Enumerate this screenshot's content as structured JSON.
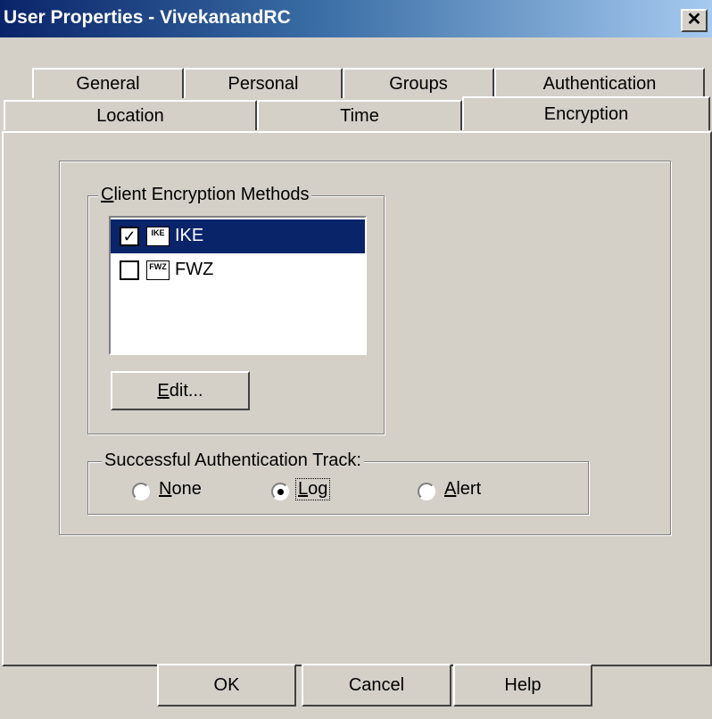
{
  "window": {
    "title": "User Properties - VivekanandRC",
    "close_glyph": "✕"
  },
  "tabs_back": [
    "General",
    "Personal",
    "Groups",
    "Authentication"
  ],
  "tabs_front": [
    "Location",
    "Time",
    "Encryption"
  ],
  "selected_tab": "Encryption",
  "encryption": {
    "group_label_ul": "C",
    "group_label_rest": "lient Encryption Methods",
    "methods": [
      {
        "label": "IKE",
        "icon_text": "IKE",
        "checked": true,
        "selected": true
      },
      {
        "label": "FWZ",
        "icon_text": "FWZ",
        "checked": false,
        "selected": false
      }
    ],
    "edit_ul": "E",
    "edit_rest": "dit..."
  },
  "track": {
    "label": "Successful Authentication Track:",
    "options": [
      {
        "ul": "N",
        "rest": "one",
        "selected": false
      },
      {
        "ul": "L",
        "rest": "og",
        "selected": true
      },
      {
        "ul": "A",
        "rest": "lert",
        "selected": false
      }
    ]
  },
  "buttons": {
    "ok": "OK",
    "cancel": "Cancel",
    "help": "Help"
  }
}
